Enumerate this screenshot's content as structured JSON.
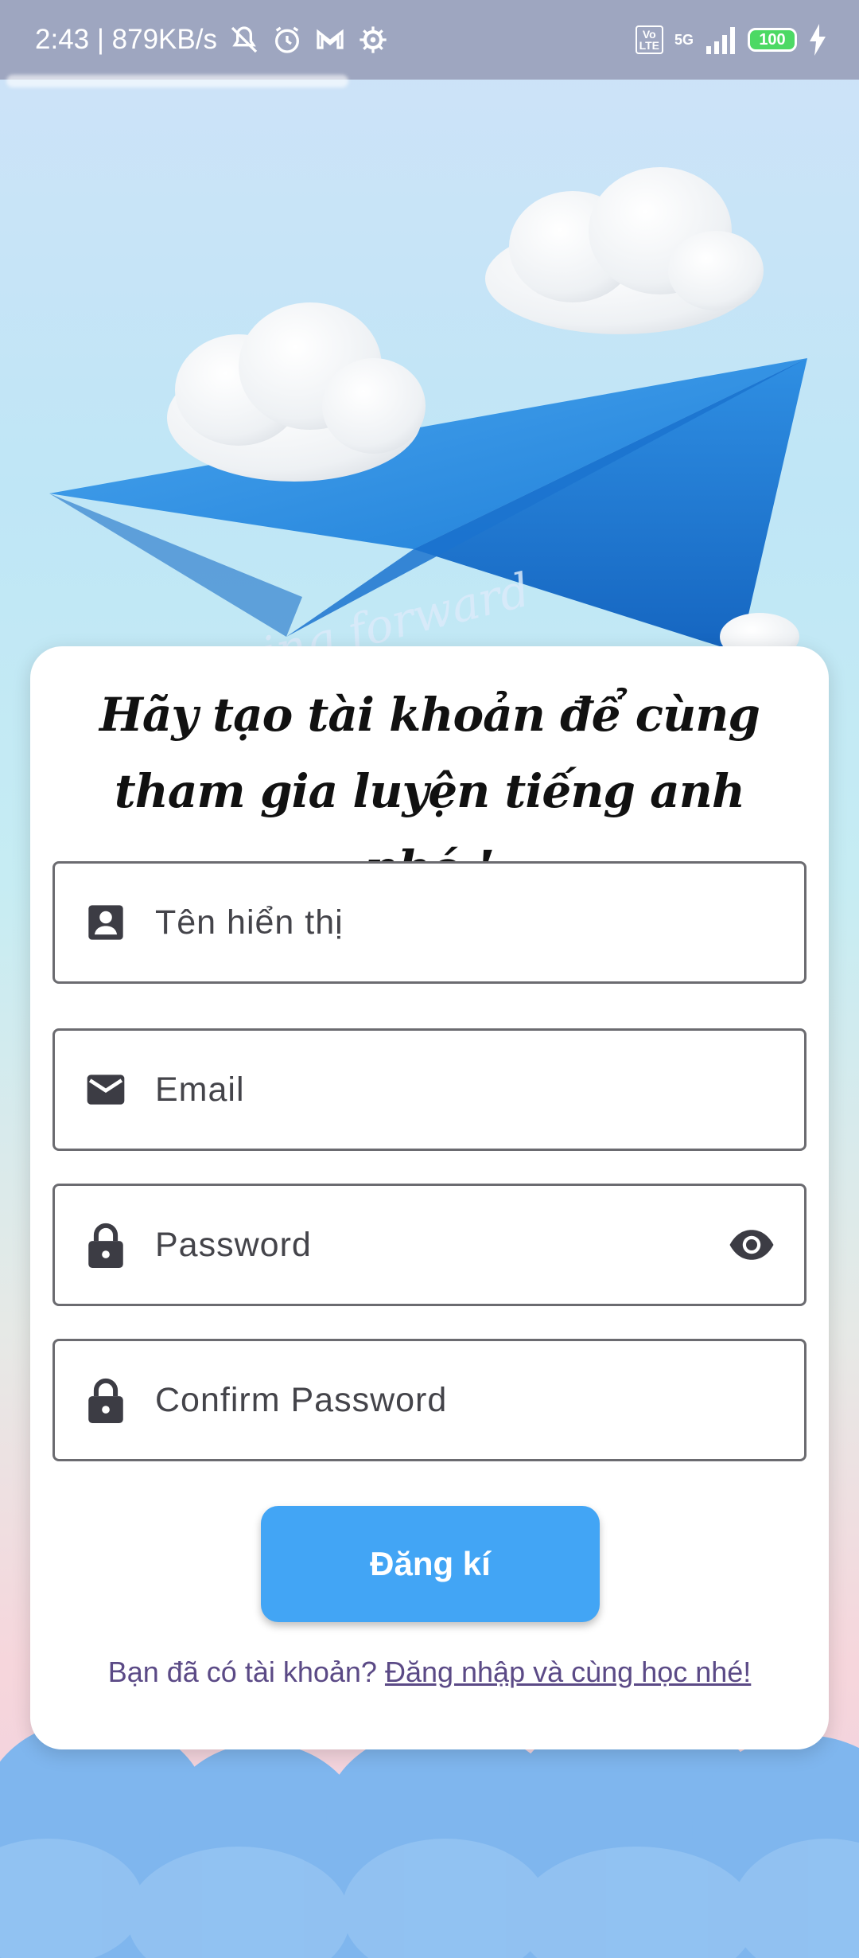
{
  "status_bar": {
    "time_speed": "2:43 | 879KB/s",
    "volte": "Vo\nLTE",
    "network": "5G",
    "battery": "100"
  },
  "hero": {
    "script_text": "ing forward"
  },
  "card": {
    "title": "Hãy tạo tài khoản để cùng tham gia luyện tiếng anh nhé !",
    "fields": [
      {
        "icon": "person-badge-icon",
        "placeholder": "Tên hiển thị"
      },
      {
        "icon": "email-icon",
        "placeholder": "Email"
      },
      {
        "icon": "lock-icon",
        "placeholder": "Password"
      },
      {
        "icon": "lock-icon",
        "placeholder": "Confirm Password"
      }
    ],
    "submit_label": "Đăng kí",
    "login_prompt": "Bạn đã có tài khoản? ",
    "login_link": "Đăng nhập và cùng học nhé!"
  },
  "colors": {
    "primary": "#42a5f5",
    "link": "#5b4a86",
    "status_bar": "#9ea6c0"
  }
}
